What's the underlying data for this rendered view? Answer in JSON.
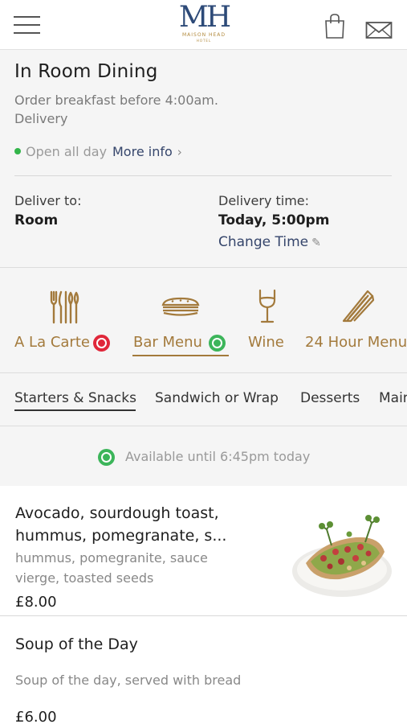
{
  "header": {
    "logo_mark": "MH",
    "logo_text": "MAISON HEAD",
    "logo_sub": "HOTEL",
    "menu_icon": "hamburger-menu-icon",
    "bag_icon": "shopping-bag-icon",
    "mail_icon": "envelope-icon"
  },
  "info": {
    "title": "In Room Dining",
    "subtitle_1": "Order breakfast before 4:00am.",
    "subtitle_2": "Delivery",
    "open_status": "Open all day",
    "open_status_color": "#33b54a",
    "more_info": "More info",
    "deliver_to_label": "Deliver to:",
    "deliver_to_value": "Room",
    "delivery_time_label": "Delivery time:",
    "delivery_time_value": "Today, 5:00pm",
    "change_time": "Change Time"
  },
  "categories": [
    {
      "label": "A La Carte",
      "icon": "cutlery-icon",
      "status": "unavailable",
      "status_color": "#e0273a"
    },
    {
      "label": "Bar Menu",
      "icon": "sandwich-icon",
      "status": "available",
      "status_color": "#3cb55a",
      "selected": true
    },
    {
      "label": "Wine",
      "icon": "wine-glass-icon"
    },
    {
      "label": "24 Hour Menu",
      "icon": "sandwich-wedge-icon"
    }
  ],
  "subtabs": [
    {
      "label": "Starters & Snacks",
      "selected": true
    },
    {
      "label": "Sandwich or Wrap"
    },
    {
      "label": "Desserts"
    },
    {
      "label": "Mains"
    }
  ],
  "availability": {
    "text": "Available until 6:45pm today"
  },
  "items": [
    {
      "name_line1": "Avocado, sourdough toast,",
      "name_line2": "hummus, pomegranate, s...",
      "desc_line1": "hummus, pomegranite, sauce",
      "desc_line2": "vierge, toasted seeds",
      "price": "£8.00",
      "photo": "avocado-toast-photo"
    },
    {
      "name_line1": "Soup of the Day",
      "desc_line1": "Soup of the day, served with bread",
      "price": "£6.00"
    }
  ],
  "colors": {
    "accent_gold": "#a37a3c",
    "link_navy": "#35456b",
    "panel_bg": "#f5f5f5"
  }
}
